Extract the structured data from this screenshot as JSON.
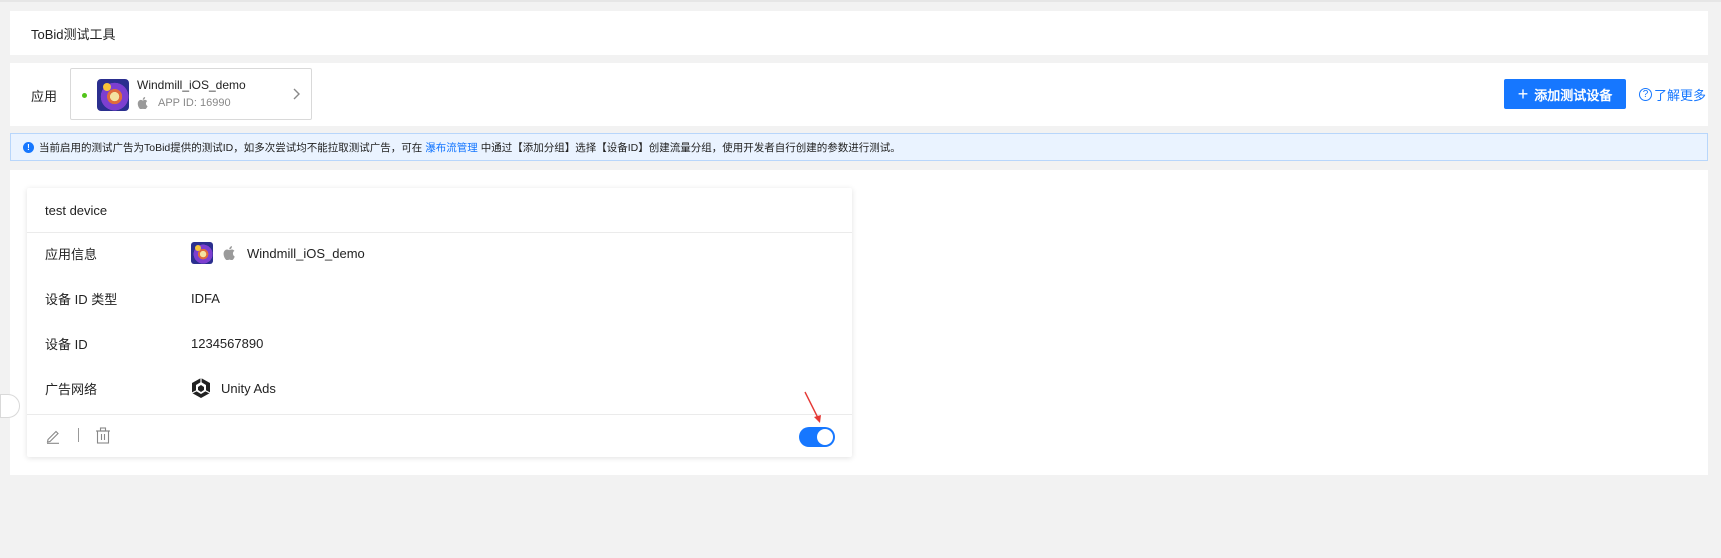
{
  "header": {
    "title": "ToBid测试工具"
  },
  "app_bar": {
    "label": "应用",
    "selected_app": {
      "name": "Windmill_iOS_demo",
      "app_id": "APP ID: 16990",
      "platform_icon": "apple-icon",
      "status_color": "#52c41a"
    },
    "add_button": {
      "icon": "plus-icon",
      "label": "添加测试设备"
    },
    "learn_more": {
      "icon": "question-circle-icon",
      "label": "了解更多"
    }
  },
  "notice": {
    "icon": "info-circle-icon",
    "text_before": "当前启用的测试广告为ToBid提供的测试ID，如多次尝试均不能拉取测试广告，可在",
    "link": "瀑布流管理",
    "text_after": "中通过【添加分组】选择【设备ID】创建流量分组，使用开发者自行创建的参数进行测试。"
  },
  "device_card": {
    "title": "test device",
    "rows": [
      {
        "key": "应用信息",
        "value": "Windmill_iOS_demo"
      },
      {
        "key": "设备 ID 类型",
        "value": "IDFA"
      },
      {
        "key": "设备 ID",
        "value": "1234567890"
      },
      {
        "key": "广告网络",
        "value": "Unity Ads"
      }
    ],
    "enabled": true
  },
  "colors": {
    "primary": "#1677ff",
    "notice_bg": "#eaf3ff",
    "annotation_arrow": "#e53935"
  }
}
